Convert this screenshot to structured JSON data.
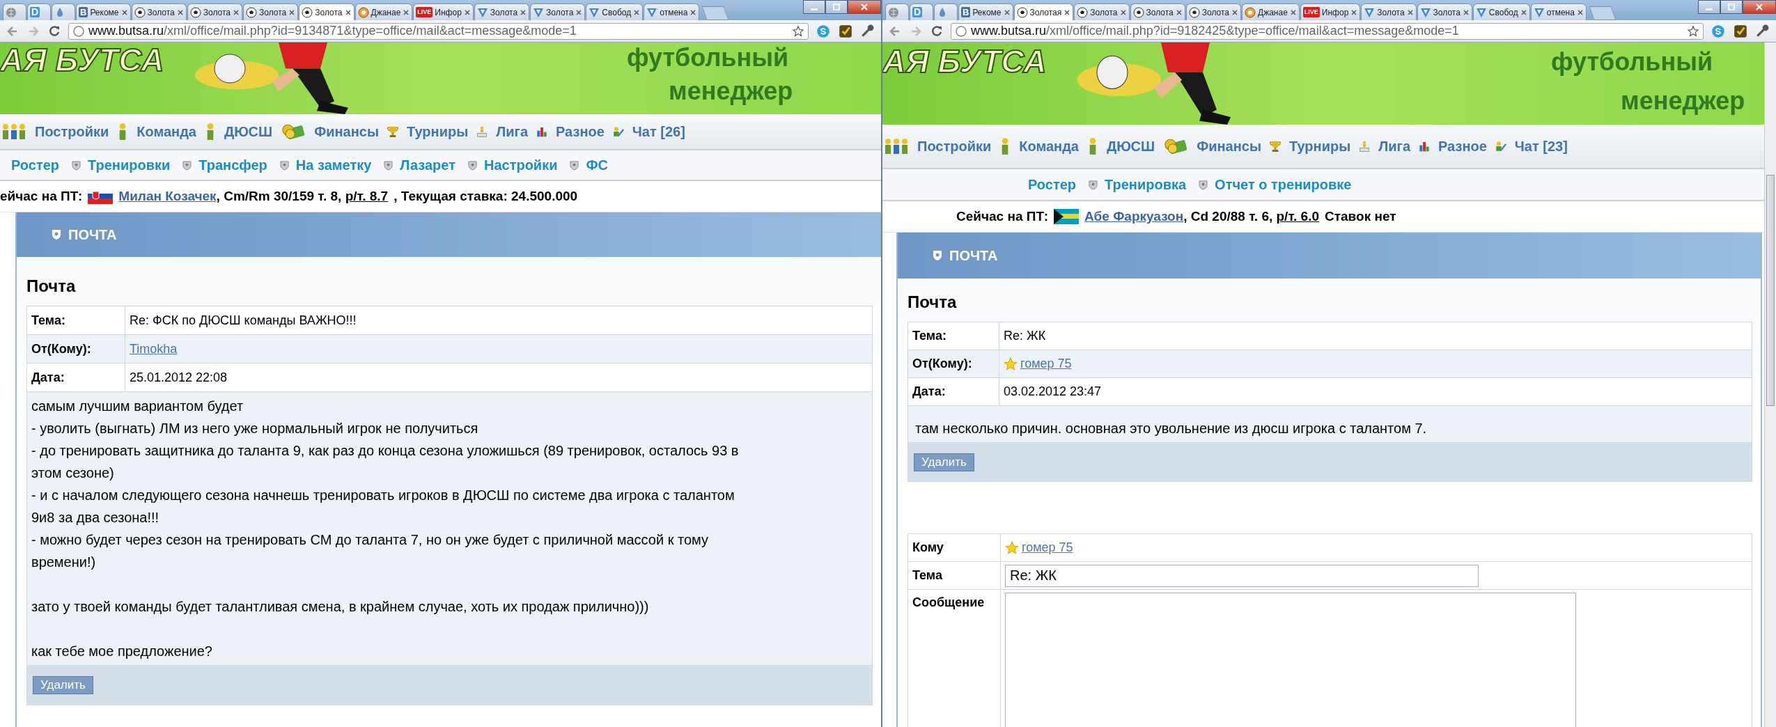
{
  "windows": [
    {
      "tabs": [
        {
          "kind": "globe",
          "selected": false
        },
        {
          "kind": "letter",
          "badge": "D",
          "selected": false
        },
        {
          "kind": "drop",
          "selected": false
        },
        {
          "kind": "letter-vk",
          "badge": "В",
          "label": "Рекоме",
          "selected": false
        },
        {
          "kind": "ball",
          "label": "Золота",
          "selected": false
        },
        {
          "kind": "ball",
          "label": "Золота",
          "selected": false
        },
        {
          "kind": "ball",
          "label": "Золота",
          "selected": false
        },
        {
          "kind": "ball",
          "label": "Золота",
          "selected": true
        },
        {
          "kind": "orange-ball",
          "label": "Джанае",
          "selected": false
        },
        {
          "kind": "live",
          "badge": "LIVE",
          "label": "Инфор",
          "selected": false
        },
        {
          "kind": "v",
          "label": "Золота",
          "selected": false
        },
        {
          "kind": "v",
          "label": "Золота",
          "selected": false
        },
        {
          "kind": "v",
          "label": "Свобод",
          "selected": false
        },
        {
          "kind": "v",
          "label": "отмена",
          "selected": false
        }
      ],
      "url": {
        "host": "www.butsa.ru",
        "path": "/xml/office/mail.php?id=9134871&type=office/mail&act=message&mode=1"
      },
      "banner": {
        "logo": "АЯ БУТСА",
        "tagline_1": "футбольный",
        "tagline_2": "менеджер"
      },
      "nav": [
        {
          "label": "Постройки",
          "kind": "people"
        },
        {
          "label": "Команда",
          "kind": "person"
        },
        {
          "label": "ДЮСШ",
          "kind": "person"
        },
        {
          "label": "Финансы",
          "kind": "coins"
        },
        {
          "label": "Турниры",
          "kind": "trophy"
        },
        {
          "label": "Лига",
          "kind": "podium"
        },
        {
          "label": "Разное",
          "kind": "chart"
        },
        {
          "label": "Чат [26]",
          "kind": "pencil"
        }
      ],
      "subnav": [
        "Ростер",
        "Тренировки",
        "Трансфер",
        "На заметку",
        "Лазарет",
        "Настройки",
        "ФС"
      ],
      "transfer": {
        "prefix": "ейчас на ПТ:",
        "player": "Милан Козачек",
        "details": ", Cm/Rm 30/159 т. 8,",
        "rating": "р/т. 8.7",
        "suffix": ", Текущая ставка: 24.500.000"
      },
      "section": "ПОЧТА",
      "heading": "Почта",
      "message": {
        "rows": [
          {
            "label": "Тема:",
            "value": "Re: ФСК по ДЮСШ команды ВАЖНО!!!",
            "kind": "text"
          },
          {
            "label": "От(Кому):",
            "value": "Timokha",
            "kind": "link"
          },
          {
            "label": "Дата:",
            "value": "25.01.2012 22:08",
            "kind": "text"
          }
        ],
        "body": "самым лучшим вариантом будет\n- уволить (выгнать) ЛМ из него уже нормальный игрок не получиться\n- до тренировать защитника до таланта 9, как раз до конца сезона уложишься (89 тренировок, осталось 93 в\nэтом сезоне)\n- и с началом следующего сезона начнешь тренировать игроков в ДЮСШ по системе два игрока с талантом\n9и8 за два сезона!!!\n- можно будет через сезон на тренировать СМ до таланта 7, но он уже будет с приличной массой к тому\nвремени!)\n\nзато у твоей команды будет талантливая смена, в крайнем случае, хоть их продаж прилично)))\n\nкак тебе мое предложение?",
        "delete": "Удалить"
      }
    },
    {
      "tabs": [
        {
          "kind": "globe",
          "selected": false
        },
        {
          "kind": "letter",
          "badge": "D",
          "selected": false
        },
        {
          "kind": "drop",
          "selected": false
        },
        {
          "kind": "letter-vk",
          "badge": "В",
          "label": "Рекоме",
          "selected": false
        },
        {
          "kind": "ball",
          "label": "Золотая",
          "selected": true
        },
        {
          "kind": "ball",
          "label": "Золота",
          "selected": false
        },
        {
          "kind": "ball",
          "label": "Золота",
          "selected": false
        },
        {
          "kind": "ball",
          "label": "Золота",
          "selected": false
        },
        {
          "kind": "orange-ball",
          "label": "Джанае",
          "selected": false
        },
        {
          "kind": "live",
          "badge": "LIVE",
          "label": "Инфор",
          "selected": false
        },
        {
          "kind": "v",
          "label": "Золота",
          "selected": false
        },
        {
          "kind": "v",
          "label": "Золота",
          "selected": false
        },
        {
          "kind": "v",
          "label": "Свобод",
          "selected": false
        },
        {
          "kind": "v",
          "label": "отмена",
          "selected": false
        }
      ],
      "url": {
        "host": "www.butsa.ru",
        "path": "/xml/office/mail.php?id=9182425&type=office/mail&act=message&mode=1"
      },
      "banner": {
        "logo": "АЯ БУТСА",
        "tagline_1": "футбольный",
        "tagline_2": "менеджер"
      },
      "nav": [
        {
          "label": "Постройки",
          "kind": "people"
        },
        {
          "label": "Команда",
          "kind": "person"
        },
        {
          "label": "ДЮСШ",
          "kind": "person"
        },
        {
          "label": "Финансы",
          "kind": "coins"
        },
        {
          "label": "Турниры",
          "kind": "trophy"
        },
        {
          "label": "Лига",
          "kind": "podium"
        },
        {
          "label": "Разное",
          "kind": "chart"
        },
        {
          "label": "Чат [23]",
          "kind": "pencil"
        }
      ],
      "subnav": [
        "Ростер",
        "Тренировка",
        "Отчет о тренировке"
      ],
      "transfer": {
        "prefix": "Сейчас на ПТ:",
        "player": "Абе Фаркуазон",
        "details": ", Cd 20/88 т. 6,",
        "rating": "р/т. 6.0",
        "suffix": "Ставок нет"
      },
      "section": "ПОЧТА",
      "heading": "Почта",
      "message": {
        "rows": [
          {
            "label": "Тема:",
            "value": "Re: ЖК",
            "kind": "text"
          },
          {
            "label": "От(Кому):",
            "value": "гомер 75",
            "kind": "star-link"
          },
          {
            "label": "Дата:",
            "value": "03.02.2012 23:47",
            "kind": "text"
          }
        ],
        "body": "там несколько причин. основная это увольнение из дюсш игрока с талантом 7.",
        "delete": "Удалить"
      },
      "reply": {
        "to_label": "Кому",
        "to_value": "гомер 75",
        "subject_label": "Тема",
        "subject_value": "Re: ЖК",
        "message_label": "Сообщение"
      }
    }
  ]
}
